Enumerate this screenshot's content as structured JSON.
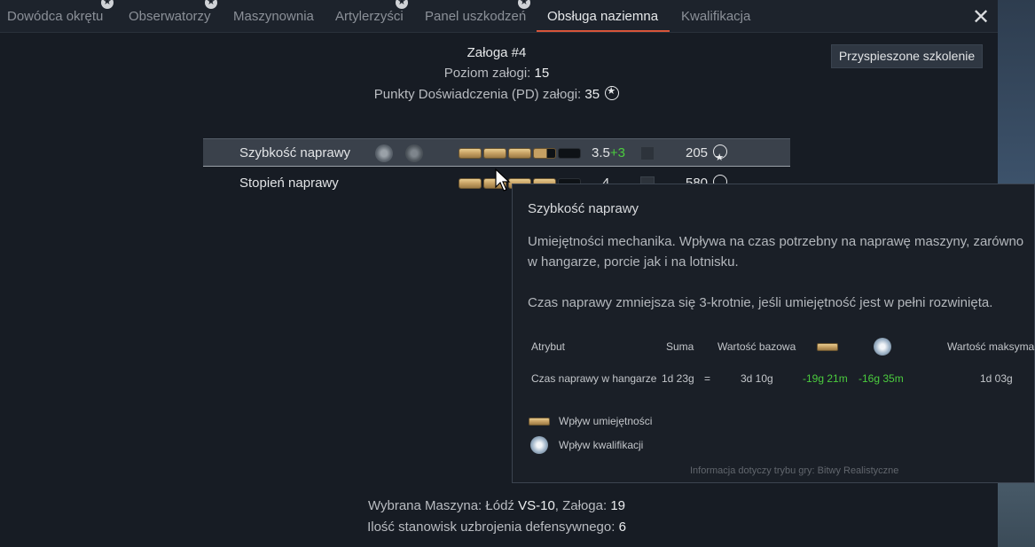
{
  "tabs": [
    {
      "label": "Dowódca okrętu",
      "active": false
    },
    {
      "label": "Obserwatorzy",
      "active": false
    },
    {
      "label": "Maszynownia",
      "active": false
    },
    {
      "label": "Artylerzyści",
      "active": false
    },
    {
      "label": "Panel uszkodzeń",
      "active": false
    },
    {
      "label": "Obsługa naziemna",
      "active": true
    },
    {
      "label": "Kwalifikacja",
      "active": false
    }
  ],
  "header": {
    "crew_title": "Załoga #4",
    "level_label": "Poziom załogi:",
    "level_value": "15",
    "points_label": "Punkty Doświadczenia (PD) załogi:",
    "points_value": "35"
  },
  "accelerated_training_label": "Przyspieszone szkolenie",
  "skills": [
    {
      "name": "Szybkość naprawy",
      "value": "3.5",
      "bonus": "+3",
      "cost": "205",
      "level_fraction": 0.7
    },
    {
      "name": "Stopień naprawy",
      "value": "4",
      "bonus": "",
      "cost": "580",
      "level_fraction": 0.8
    }
  ],
  "tooltip": {
    "title": "Szybkość naprawy",
    "description": "Umiejętności mechanika. Wpływa na czas potrzebny na naprawę maszyny, zarówno w hangarze, porcie jak i na lotnisku.",
    "note": "Czas naprawy zmniejsza się 3-krotnie, jeśli umiejętność jest w pełni rozwinięta.",
    "table_headers": {
      "attribute": "Atrybut",
      "sum": "Suma",
      "base": "Wartość bazowa",
      "max": "Wartość maksymal"
    },
    "row": {
      "attribute": "Czas naprawy w hangarze",
      "sum": "1d 23g",
      "equals": "=",
      "base": "3d 10g",
      "skill_effect": "-19g 21m",
      "qualification_effect": "-16g 35m",
      "max": "1d 03g"
    },
    "legend_skill": "Wpływ umiejętności",
    "legend_qualification": "Wpływ kwalifikacji",
    "footer": "Informacja dotyczy trybu gry: Bitwy Realistyczne"
  },
  "bottom": {
    "vehicle_label": "Wybrana Maszyna: Łódź",
    "vehicle_name": "VS-10",
    "crew_label": ", Załoga:",
    "crew_value": "19",
    "turrets_label": "Ilość stanowisk uzbrojenia defensywnego:",
    "turrets_value": "6"
  },
  "colors": {
    "accent_tab": "#d8553a",
    "bonus_green": "#4bcc3e",
    "skill_bar": "#c5a063"
  }
}
